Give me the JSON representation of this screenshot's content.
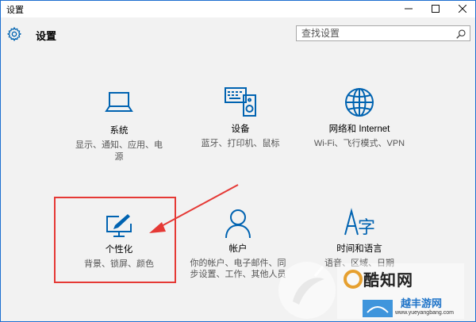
{
  "window": {
    "title": "设置",
    "controls": [
      "minimize",
      "maximize",
      "close"
    ]
  },
  "header": {
    "title": "设置",
    "search_placeholder": "查找设置"
  },
  "tiles": [
    {
      "name": "系统",
      "desc": "显示、通知、应用、电源",
      "icon": "laptop-icon"
    },
    {
      "name": "设备",
      "desc": "蓝牙、打印机、鼠标",
      "icon": "keyboard-speaker-icon"
    },
    {
      "name": "网络和 Internet",
      "desc": "Wi-Fi、飞行模式、VPN",
      "icon": "globe-icon"
    },
    {
      "name": "个性化",
      "desc": "背景、锁屏、颜色",
      "icon": "paint-monitor-icon"
    },
    {
      "name": "帐户",
      "desc": "你的帐户、电子邮件、同步设置、工作、其他人员",
      "icon": "person-icon"
    },
    {
      "name": "时间和语言",
      "desc": "语音、区域、日期",
      "icon": "time-language-icon"
    }
  ],
  "watermark": {
    "brand": "酷知网",
    "site": "www.yueyangbang.com",
    "tagline": "越丰游网"
  },
  "colors": {
    "accent": "#0063b1",
    "highlight": "#e53935",
    "border": "#1e6fd0"
  }
}
